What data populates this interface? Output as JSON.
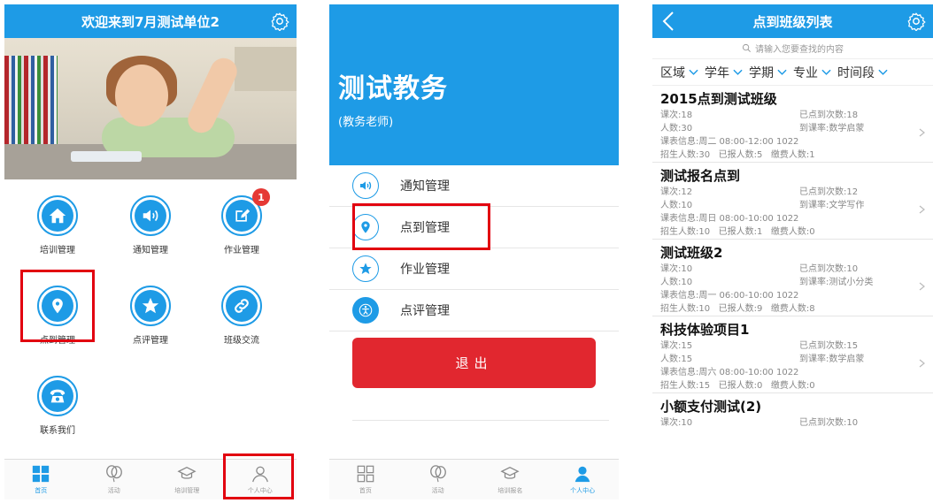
{
  "phone1": {
    "header_title": "欢迎来到7月测试单位2",
    "grid_items": [
      {
        "label": "培训管理",
        "icon": "home-icon"
      },
      {
        "label": "通知管理",
        "icon": "speaker-icon"
      },
      {
        "label": "作业管理",
        "icon": "edit-icon",
        "badge": "1"
      },
      {
        "label": "点到管理",
        "icon": "location-pin-icon"
      },
      {
        "label": "点评管理",
        "icon": "star-icon"
      },
      {
        "label": "班级交流",
        "icon": "link-icon"
      },
      {
        "label": "联系我们",
        "icon": "phone-icon"
      }
    ],
    "tabs": [
      {
        "label": "首页",
        "icon": "grid-icon"
      },
      {
        "label": "活动",
        "icon": "balloon-icon"
      },
      {
        "label": "培训管理",
        "icon": "mortarboard-icon"
      },
      {
        "label": "个人中心",
        "icon": "person-icon"
      }
    ]
  },
  "phone2": {
    "title": "测试教务",
    "subtitle": "(教务老师)",
    "menu": [
      {
        "label": "通知管理",
        "icon": "speaker-icon"
      },
      {
        "label": "点到管理",
        "icon": "location-pin-icon"
      },
      {
        "label": "作业管理",
        "icon": "star-icon"
      },
      {
        "label": "点评管理",
        "icon": "accessibility-icon"
      }
    ],
    "logout_label": "退出",
    "tabs": [
      {
        "label": "首页",
        "icon": "grid-icon"
      },
      {
        "label": "活动",
        "icon": "balloon-icon"
      },
      {
        "label": "培训报名",
        "icon": "mortarboard-icon"
      },
      {
        "label": "个人中心",
        "icon": "person-icon"
      }
    ]
  },
  "phone3": {
    "header_title": "点到班级列表",
    "search_placeholder": "请输入您要查找的内容",
    "filters": [
      "区域",
      "学年",
      "学期",
      "专业",
      "时间段"
    ],
    "classes": [
      {
        "name": "2015点到测试班级",
        "lesson": "课次:18",
        "done": "已点到次数:18",
        "people": "人数:30",
        "rate": "到课率:数学启蒙",
        "schedule": "课表信息:周二 08:00-12:00 1022",
        "enroll": "招生人数:30   已报人数:5   缴费人数:1"
      },
      {
        "name": "测试报名点到",
        "lesson": "课次:12",
        "done": "已点到次数:12",
        "people": "人数:10",
        "rate": "到课率:文学写作",
        "schedule": "课表信息:周日 08:00-10:00 1022",
        "enroll": "招生人数:10   已报人数:1   缴费人数:0"
      },
      {
        "name": "测试班级2",
        "lesson": "课次:10",
        "done": "已点到次数:10",
        "people": "人数:10",
        "rate": "到课率:测试小分类",
        "schedule": "课表信息:周一 06:00-10:00 1022",
        "enroll": "招生人数:10   已报人数:9   缴费人数:8"
      },
      {
        "name": "科技体验项目1",
        "lesson": "课次:15",
        "done": "已点到次数:15",
        "people": "人数:15",
        "rate": "到课率:数学启蒙",
        "schedule": "课表信息:周六 08:00-10:00 1022",
        "enroll": "招生人数:15   已报人数:0   缴费人数:0"
      },
      {
        "name": "小额支付测试(2)",
        "lesson": "课次:10",
        "done": "已点到次数:10"
      }
    ]
  },
  "colors": {
    "brand": "#1e9be6",
    "highlight": "#e2000f",
    "danger": "#e1272f"
  }
}
